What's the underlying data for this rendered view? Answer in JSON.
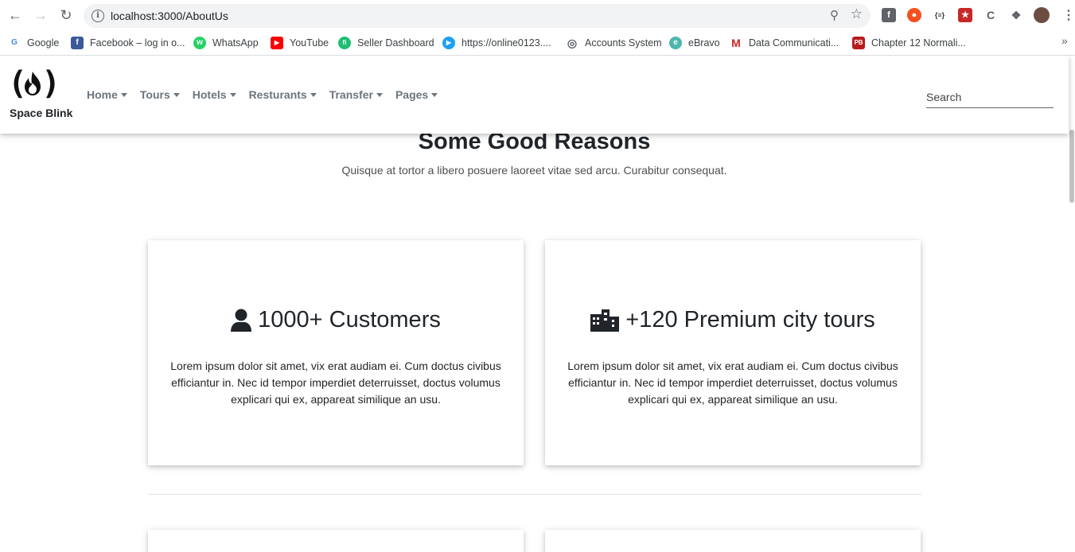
{
  "browser": {
    "url": "localhost:3000/AboutUs",
    "bookmarks": [
      {
        "label": "Google",
        "color": "#4285f4",
        "glyph": "G"
      },
      {
        "label": "Facebook – log in o...",
        "color": "#3b5998",
        "glyph": "f"
      },
      {
        "label": "WhatsApp",
        "color": "#25d366",
        "glyph": "w"
      },
      {
        "label": "YouTube",
        "color": "#ff0000",
        "glyph": "▶"
      },
      {
        "label": "Seller Dashboard",
        "color": "#1dbf73",
        "glyph": "fi"
      },
      {
        "label": "https://online0123....",
        "color": "#1da1f2",
        "glyph": "▶"
      },
      {
        "label": "Accounts System",
        "color": "#5f6368",
        "glyph": "◎"
      },
      {
        "label": "eBravo",
        "color": "#4db6ac",
        "glyph": "e"
      },
      {
        "label": "Data Communicati...",
        "color": "#c62828",
        "glyph": "M"
      },
      {
        "label": "Chapter 12 Normali...",
        "color": "#b71c1c",
        "glyph": "PB"
      }
    ]
  },
  "navbar": {
    "brand": "Space Blink",
    "menu": [
      "Home",
      "Tours",
      "Hotels",
      "Resturants",
      "Transfer",
      "Pages"
    ],
    "search_placeholder": "Search"
  },
  "section": {
    "title": "Some Good Reasons",
    "subtitle": "Quisque at tortor a libero posuere laoreet vitae sed arcu. Curabitur consequat."
  },
  "cards": [
    {
      "icon": "user-icon",
      "title": "1000+ Customers",
      "text": "Lorem ipsum dolor sit amet, vix erat audiam ei. Cum doctus civibus efficiantur in. Nec id tempor imperdiet deterruisset, doctus volumus explicari qui ex, appareat similique an usu."
    },
    {
      "icon": "city-icon",
      "title": "+120 Premium city tours",
      "text": "Lorem ipsum dolor sit amet, vix erat audiam ei. Cum doctus civibus efficiantur in. Nec id tempor imperdiet deterruisset, doctus volumus explicari qui ex, appareat similique an usu."
    }
  ]
}
